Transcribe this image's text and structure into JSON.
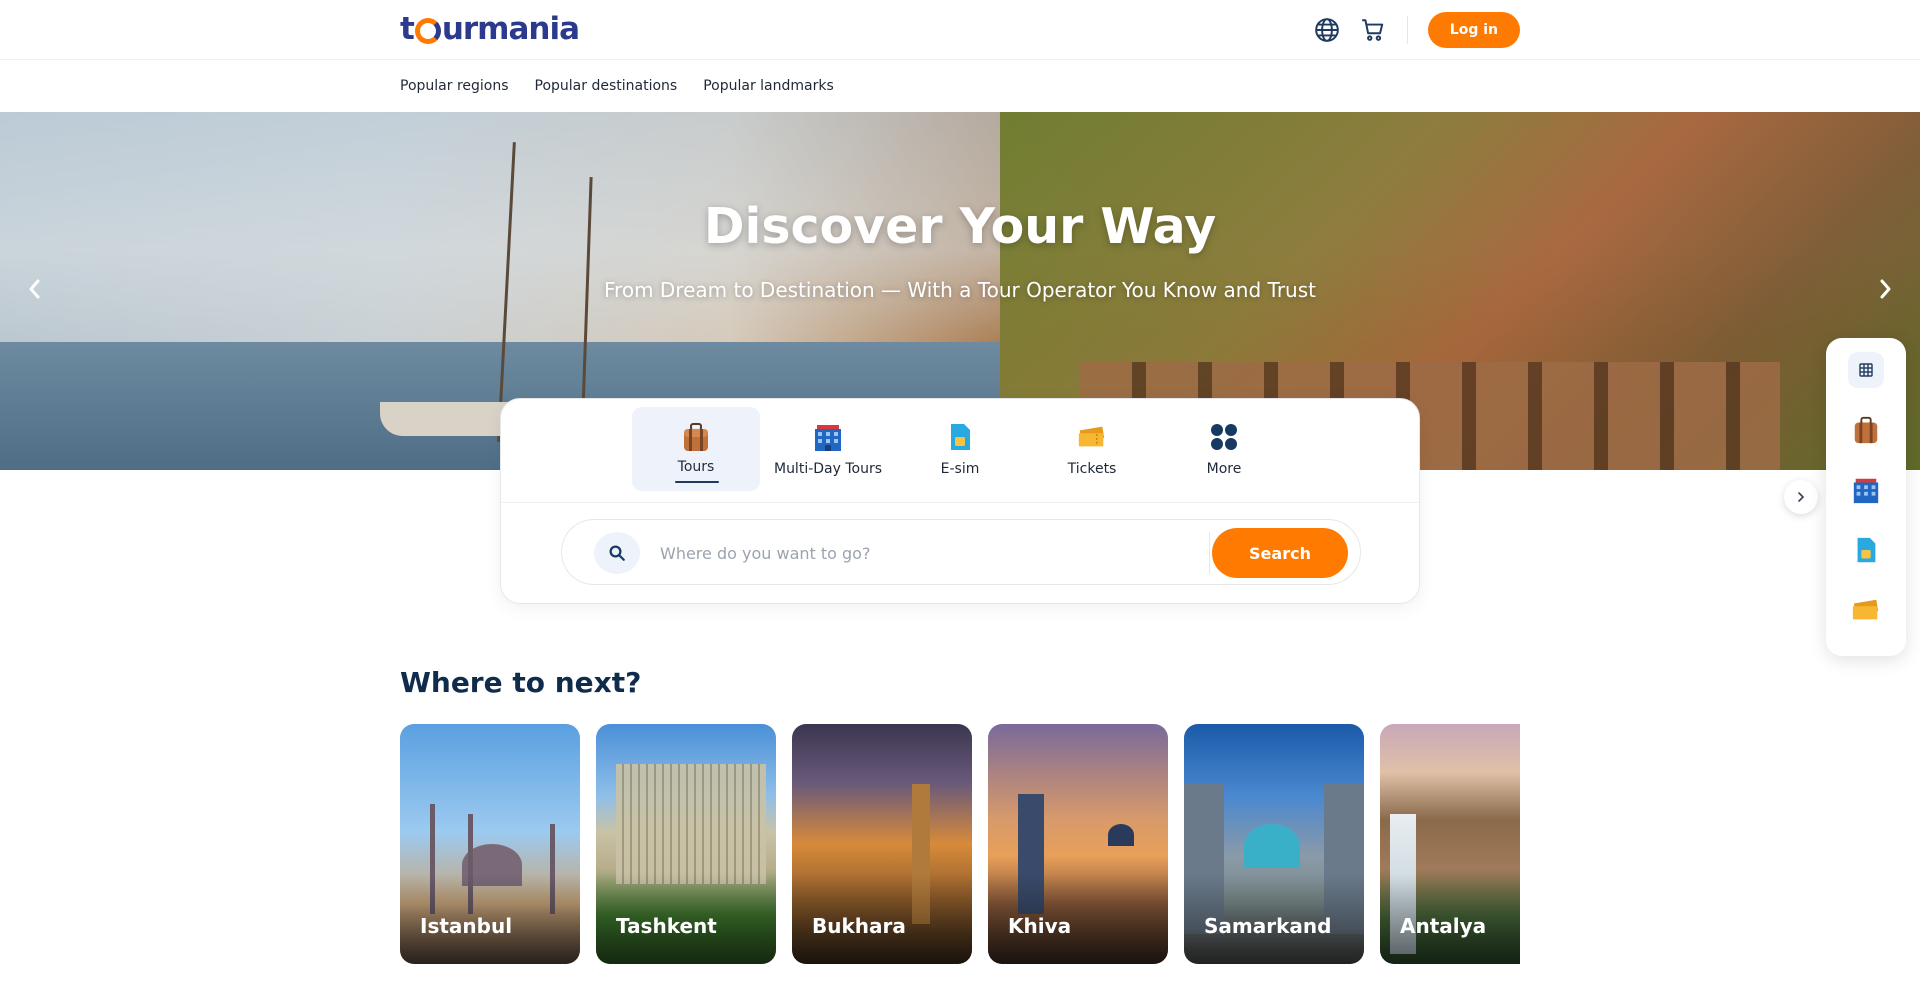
{
  "header": {
    "logo_text_1": "t",
    "logo_text_2": "urmania",
    "login_label": "Log in",
    "globe_icon": "globe-icon",
    "cart_icon": "cart-icon"
  },
  "subnav": {
    "items": [
      {
        "label": "Popular regions"
      },
      {
        "label": "Popular destinations"
      },
      {
        "label": "Popular landmarks"
      }
    ]
  },
  "hero": {
    "title": "Discover Your Way",
    "subtitle": "From Dream to Destination — With a Tour Operator You Know and Trust"
  },
  "categories": [
    {
      "label": "Tours",
      "icon": "suitcase-icon",
      "active": true
    },
    {
      "label": "Multi-Day Tours",
      "icon": "hotel-icon",
      "active": false
    },
    {
      "label": "E-sim",
      "icon": "sim-card-icon",
      "active": false
    },
    {
      "label": "Tickets",
      "icon": "ticket-icon",
      "active": false
    },
    {
      "label": "More",
      "icon": "more-grid-icon",
      "active": false
    }
  ],
  "search": {
    "placeholder": "Where do you want to go?",
    "button_label": "Search"
  },
  "side_rail": {
    "items": [
      "grid-icon",
      "suitcase-icon",
      "hotel-icon",
      "sim-card-icon",
      "ticket-icon"
    ]
  },
  "where_next": {
    "title": "Where to next?",
    "cards": [
      {
        "name": "Istanbul"
      },
      {
        "name": "Tashkent"
      },
      {
        "name": "Bukhara"
      },
      {
        "name": "Khiva"
      },
      {
        "name": "Samarkand"
      },
      {
        "name": "Antalya"
      }
    ]
  },
  "colors": {
    "accent": "#ff7a00",
    "brand_blue": "#2b3a8c",
    "heading": "#0f2c4c"
  }
}
